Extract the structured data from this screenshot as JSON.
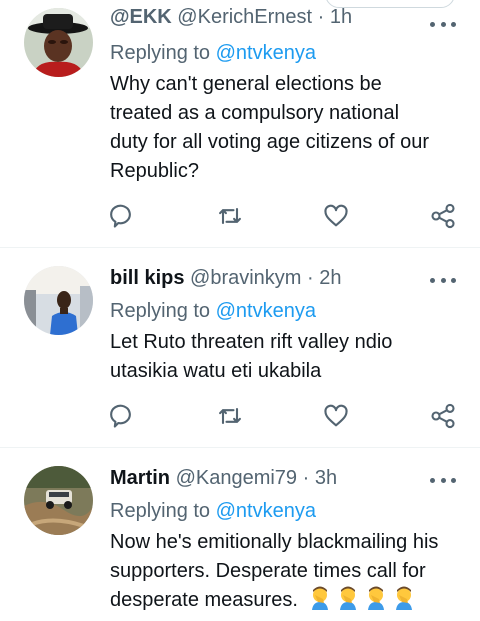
{
  "tweets": [
    {
      "name": "@EKK",
      "handle": "@KerichErnest",
      "separator": "·",
      "time": "1h",
      "replying_label": "Replying to",
      "mention": "@ntvkenya",
      "text_lines": [
        "Why can't general elections be",
        "treated as a compulsory  national",
        "duty for all voting age citizens of our",
        "Republic?"
      ]
    },
    {
      "name": "bill kips",
      "handle": "@bravinkym",
      "separator": "·",
      "time": "2h",
      "replying_label": "Replying to",
      "mention": "@ntvkenya",
      "text_lines": [
        "Let Ruto threaten rift valley ndio",
        "utasikia watu eti ukabila"
      ]
    },
    {
      "name": "Martin",
      "handle": "@Kangemi79",
      "separator": "·",
      "time": "3h",
      "replying_label": "Replying to",
      "mention": "@ntvkenya",
      "text_lines": [
        "Now he's emitionally blackmailing his",
        "supporters. Desperate times call for",
        "desperate measures."
      ],
      "emoji_count": 4
    }
  ],
  "icons": [
    "reply-icon",
    "retweet-icon",
    "like-icon",
    "share-icon",
    "more-icon"
  ],
  "colors": {
    "link": "#1d9bf0",
    "secondary_text": "#536471",
    "primary_text": "#0f1419",
    "divider": "#eff3f4"
  }
}
